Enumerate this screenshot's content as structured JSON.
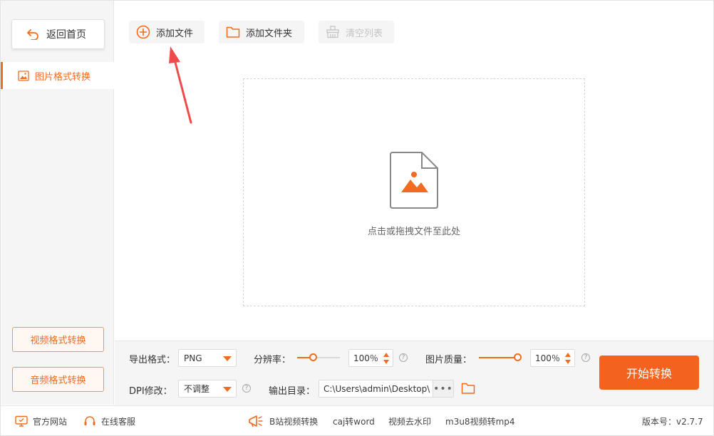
{
  "sidebar": {
    "back_label": "返回首页",
    "active_item": "图片格式转换",
    "video_btn": "视频格式转换",
    "audio_btn": "音频格式转换"
  },
  "toolbar": {
    "add_file": "添加文件",
    "add_folder": "添加文件夹",
    "clear_list": "清空列表"
  },
  "dropzone": {
    "hint": "点击或拖拽文件至此处"
  },
  "settings": {
    "export_format_label": "导出格式：",
    "export_format_value": "PNG",
    "resolution_label": "分辨率：",
    "resolution_value": "100％",
    "resolution_fraction": 0.35,
    "quality_label": "图片质量：",
    "quality_value": "100％",
    "quality_fraction": 1.0,
    "dpi_label": "DPI修改：",
    "dpi_value": "不调整",
    "output_dir_label": "输出目录：",
    "output_dir_value": "C:\\Users\\admin\\Desktop\\",
    "more_label": "•••",
    "help_glyph": "?",
    "start_button": "开始转换"
  },
  "footer": {
    "website": "官方网站",
    "service": "在线客服",
    "link1": "B站视频转换",
    "link2": "caj转word",
    "link3": "视频去水印",
    "link4": "m3u8视频转mp4",
    "version": "版本号：v2.7.7"
  },
  "colors": {
    "accent": "#f26b1f",
    "start_button": "#f4621f",
    "arrow": "#f04b4b"
  }
}
